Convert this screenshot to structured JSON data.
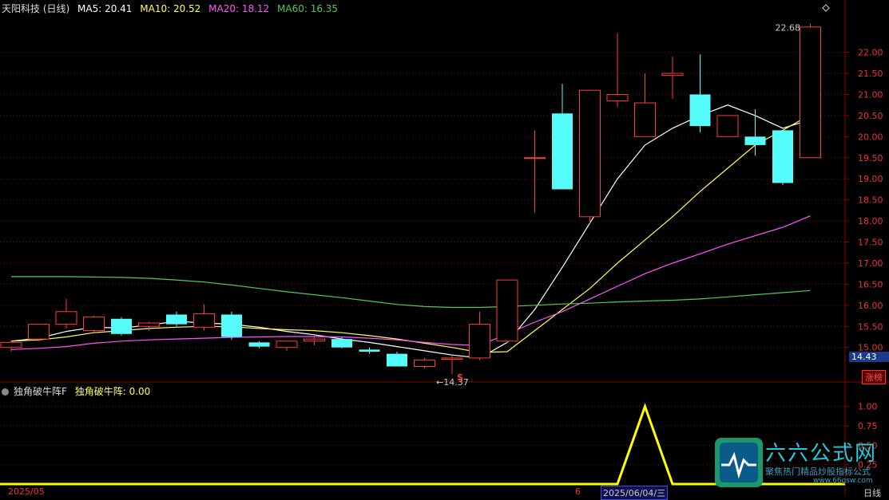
{
  "header": {
    "stock_label": "天阳科技 (日线)",
    "ma5_label": "MA5: 20.41",
    "ma10_label": "MA10: 20.52",
    "ma20_label": "MA20: 18.12",
    "ma60_label": "MA60: 16.35"
  },
  "indicator_header": {
    "name": "独角破牛阵F",
    "value_label": "独角破牛阵: 0.00"
  },
  "tags": {
    "last_price": "14.43",
    "rank": "涨榜",
    "s_marker": "S",
    "high_mark": "22.68",
    "low_mark": "←14.37"
  },
  "axis_dates": {
    "left": "2025/05",
    "cursor": "2025/06/04/三",
    "marker": "6",
    "period": "日线"
  },
  "watermark": {
    "name": "六六公式网",
    "slogan": "聚焦热门精品炒股指标公式",
    "url": "www.66gsw.com"
  },
  "colors": {
    "up": "#ff3c3c",
    "down": "#54fcfc",
    "ma5": "#ffffff",
    "ma10": "#ffff54",
    "ma20": "#ff54ff",
    "ma60": "#54c854",
    "indicator": "#ffff00",
    "grid": "#8b0000"
  },
  "chart_data": [
    {
      "type": "candlestick",
      "title": "天阳科技 (日线)",
      "ylim": [
        14.2,
        22.9
      ],
      "yticks": [
        "15.00",
        "15.50",
        "16.00",
        "16.50",
        "17.00",
        "17.50",
        "18.00",
        "18.50",
        "19.00",
        "19.50",
        "20.00",
        "20.50",
        "21.00",
        "21.50",
        "22.00"
      ],
      "candles": [
        {
          "o": 15.0,
          "h": 15.15,
          "l": 14.9,
          "c": 15.12
        },
        {
          "o": 15.2,
          "h": 15.55,
          "l": 15.15,
          "c": 15.55
        },
        {
          "o": 15.55,
          "h": 16.15,
          "l": 15.45,
          "c": 15.85
        },
        {
          "o": 15.4,
          "h": 15.75,
          "l": 15.35,
          "c": 15.72
        },
        {
          "o": 15.68,
          "h": 15.72,
          "l": 15.28,
          "c": 15.32
        },
        {
          "o": 15.5,
          "h": 15.6,
          "l": 15.4,
          "c": 15.58
        },
        {
          "o": 15.78,
          "h": 15.85,
          "l": 15.5,
          "c": 15.55
        },
        {
          "o": 15.48,
          "h": 16.02,
          "l": 15.4,
          "c": 15.8
        },
        {
          "o": 15.78,
          "h": 15.85,
          "l": 15.18,
          "c": 15.25
        },
        {
          "o": 15.12,
          "h": 15.15,
          "l": 14.98,
          "c": 15.02
        },
        {
          "o": 15.0,
          "h": 15.15,
          "l": 14.92,
          "c": 15.15
        },
        {
          "o": 15.15,
          "h": 15.28,
          "l": 15.05,
          "c": 15.2
        },
        {
          "o": 15.2,
          "h": 15.25,
          "l": 14.98,
          "c": 15.0
        },
        {
          "o": 14.95,
          "h": 15.0,
          "l": 14.85,
          "c": 14.9
        },
        {
          "o": 14.85,
          "h": 14.9,
          "l": 14.55,
          "c": 14.55
        },
        {
          "o": 14.55,
          "h": 14.75,
          "l": 14.5,
          "c": 14.7
        },
        {
          "o": 14.72,
          "h": 14.8,
          "l": 14.37,
          "c": 14.75
        },
        {
          "o": 14.75,
          "h": 15.85,
          "l": 14.7,
          "c": 15.55
        },
        {
          "o": 15.15,
          "h": 16.6,
          "l": 15.1,
          "c": 16.6
        },
        {
          "o": 19.5,
          "h": 20.15,
          "l": 18.2,
          "c": 19.5
        },
        {
          "o": 20.55,
          "h": 21.25,
          "l": 18.75,
          "c": 18.75
        },
        {
          "o": 18.1,
          "h": 21.1,
          "l": 17.95,
          "c": 21.1
        },
        {
          "o": 20.85,
          "h": 22.45,
          "l": 20.7,
          "c": 21.0
        },
        {
          "o": 20.0,
          "h": 21.5,
          "l": 20.0,
          "c": 20.8
        },
        {
          "o": 21.45,
          "h": 21.9,
          "l": 20.9,
          "c": 21.5
        },
        {
          "o": 21.0,
          "h": 21.95,
          "l": 20.1,
          "c": 20.25
        },
        {
          "o": 20.0,
          "h": 20.5,
          "l": 20.0,
          "c": 20.5
        },
        {
          "o": 20.0,
          "h": 20.65,
          "l": 19.55,
          "c": 19.8
        },
        {
          "o": 20.15,
          "h": 20.15,
          "l": 18.85,
          "c": 18.9
        },
        {
          "o": 19.5,
          "h": 22.68,
          "l": 19.5,
          "c": 22.6
        }
      ],
      "series": [
        {
          "name": "MA5",
          "values": [
            15.15,
            15.22,
            15.38,
            15.48,
            15.46,
            15.53,
            15.62,
            15.58,
            15.55,
            15.48,
            15.38,
            15.3,
            15.2,
            15.12,
            15.02,
            14.92,
            14.82,
            14.75,
            15.12,
            15.9,
            16.9,
            17.95,
            19.0,
            19.8,
            20.2,
            20.5,
            20.75,
            20.5,
            20.2,
            20.4
          ]
        },
        {
          "name": "MA10",
          "values": [
            15.15,
            15.18,
            15.25,
            15.35,
            15.4,
            15.45,
            15.48,
            15.5,
            15.49,
            15.45,
            15.42,
            15.4,
            15.35,
            15.28,
            15.2,
            15.1,
            15.0,
            14.88,
            14.9,
            15.4,
            15.9,
            16.4,
            17.0,
            17.55,
            18.1,
            18.7,
            19.25,
            19.8,
            20.15,
            20.52
          ]
        },
        {
          "name": "MA20",
          "values": [
            14.95,
            14.98,
            15.02,
            15.1,
            15.15,
            15.18,
            15.2,
            15.22,
            15.24,
            15.25,
            15.26,
            15.26,
            15.25,
            15.22,
            15.18,
            15.12,
            15.07,
            15.05,
            15.32,
            15.6,
            15.85,
            16.15,
            16.45,
            16.75,
            17.0,
            17.22,
            17.45,
            17.65,
            17.85,
            18.12
          ]
        },
        {
          "name": "MA60",
          "values": [
            16.68,
            16.68,
            16.68,
            16.67,
            16.66,
            16.64,
            16.6,
            16.55,
            16.48,
            16.4,
            16.32,
            16.25,
            16.18,
            16.1,
            16.02,
            15.97,
            15.95,
            15.95,
            15.97,
            16.0,
            16.03,
            16.05,
            16.08,
            16.1,
            16.12,
            16.15,
            16.2,
            16.25,
            16.3,
            16.35
          ]
        }
      ],
      "signal": {
        "index": 16,
        "label": "S"
      }
    },
    {
      "type": "line",
      "title": "独角破牛阵F",
      "ylim": [
        0,
        1.1
      ],
      "yticks": [
        "0.25",
        "0.50",
        "0.75",
        "1.00"
      ],
      "series": [
        {
          "name": "独角破牛阵",
          "values": [
            0,
            0,
            0,
            0,
            0,
            0,
            0,
            0,
            0,
            0,
            0,
            0,
            0,
            0,
            0,
            0,
            0,
            0,
            0,
            0,
            0,
            0,
            0,
            1,
            0,
            0,
            0,
            0,
            0,
            0
          ]
        }
      ]
    }
  ]
}
